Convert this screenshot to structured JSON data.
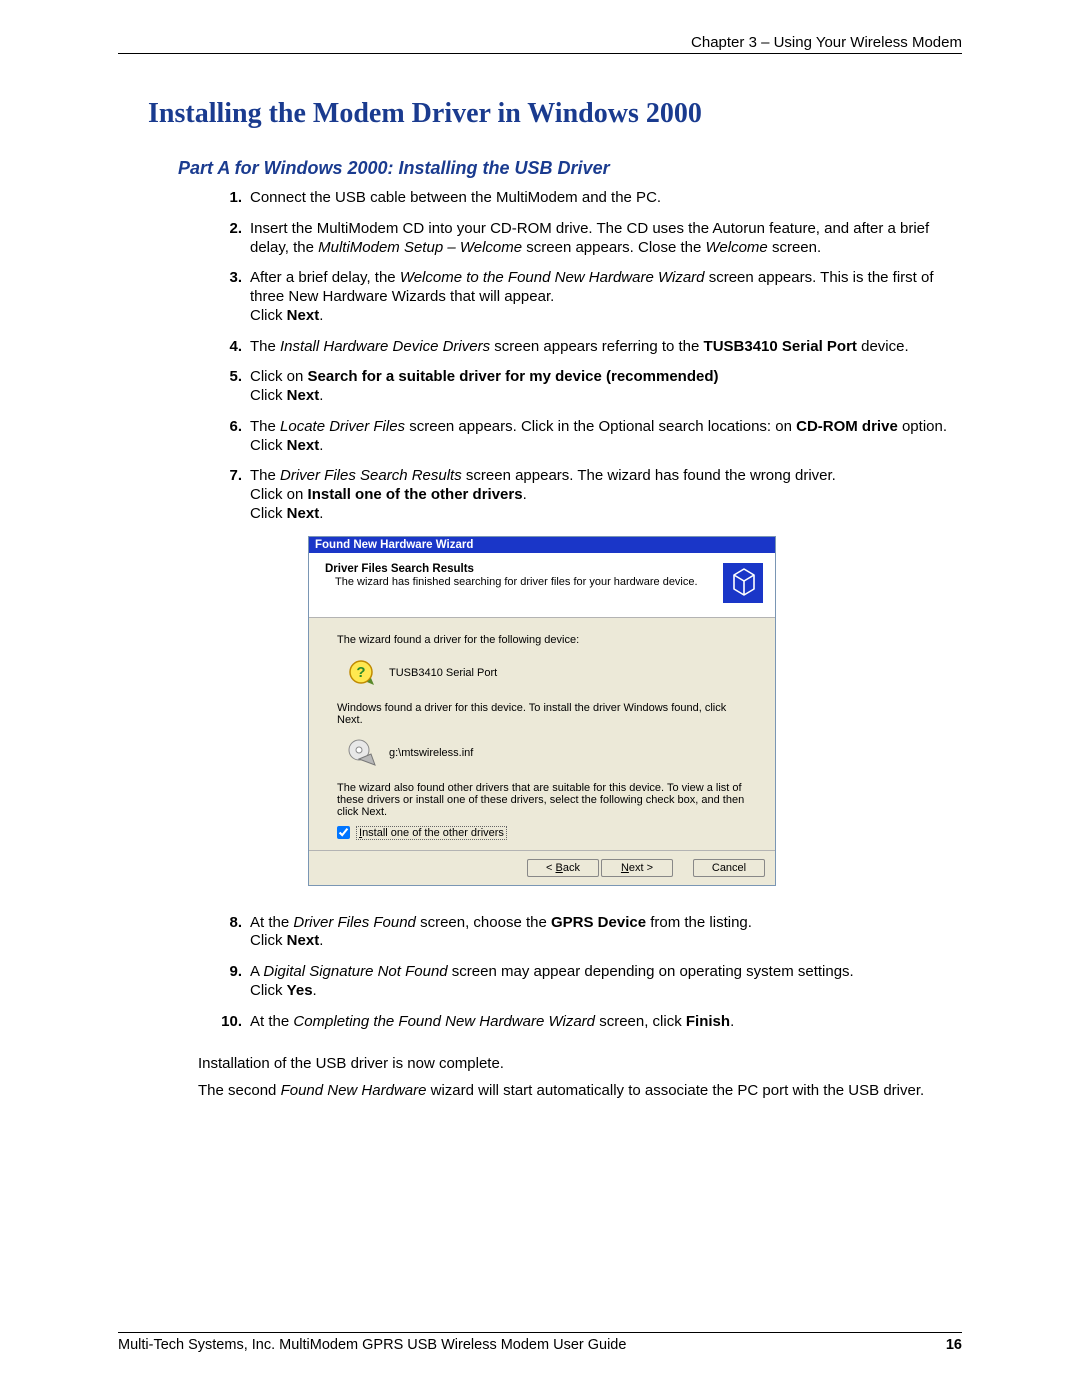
{
  "header": {
    "chapter": "Chapter 3 – Using Your Wireless Modem"
  },
  "h1": "Installing the Modem Driver in Windows 2000",
  "h2": "Part A for Windows 2000: Installing the USB Driver",
  "steps_a": {
    "s1_num": "1.",
    "s1": "Connect the USB cable between the MultiModem and the PC.",
    "s2_num": "2.",
    "s2_a": "Insert the MultiModem CD into your CD-ROM drive. The CD uses the Autorun feature, and after a brief delay, the ",
    "s2_i1": "MultiModem Setup – Welcome",
    "s2_b": " screen appears. Close the ",
    "s2_i2": "Welcome",
    "s2_c": " screen.",
    "s3_num": "3.",
    "s3_a": "After a brief delay, the ",
    "s3_i1": "Welcome to the Found New Hardware Wizard",
    "s3_b": " screen appears. This is the first of three New Hardware Wizards that will appear.",
    "s3_click_a": "Click ",
    "s3_click_b": "Next",
    "s3_click_c": ".",
    "s4_num": "4.",
    "s4_a": "The ",
    "s4_i1": "Install Hardware Device Drivers",
    "s4_b": " screen appears referring to the ",
    "s4_bold": "TUSB3410 Serial Port",
    "s4_c": " device.",
    "s5_num": "5.",
    "s5_a": "Click on ",
    "s5_bold": "Search for a suitable driver for my device (recommended)",
    "s5_click_a": "Click ",
    "s5_click_b": "Next",
    "s5_click_c": ".",
    "s6_num": "6.",
    "s6_a": "The ",
    "s6_i1": "Locate Driver Files",
    "s6_b": " screen appears. Click in the Optional search locations: on ",
    "s6_bold": "CD-ROM drive",
    "s6_c": " option.",
    "s6_click_a": "Click ",
    "s6_click_b": "Next",
    "s6_click_c": ".",
    "s7_num": "7.",
    "s7_a": "The ",
    "s7_i1": "Driver Files Search Results",
    "s7_b": " screen appears. The wizard has found the wrong driver.",
    "s7_line2_a": "Click on ",
    "s7_line2_b": "Install one of the other drivers",
    "s7_line2_c": ".",
    "s7_click_a": "Click ",
    "s7_click_b": "Next",
    "s7_click_c": "."
  },
  "wizard": {
    "title": "Found New Hardware Wizard",
    "head_title": "Driver Files Search Results",
    "head_sub": "The wizard has finished searching for driver files for your hardware device.",
    "b1": "The wizard found a driver for the following device:",
    "device": "TUSB3410 Serial Port",
    "b2": "Windows found a driver for this device. To install the driver Windows found, click Next.",
    "path": "g:\\mtswireless.inf",
    "b3": "The wizard also found other drivers that are suitable for this device. To view a list of these drivers or install one of these drivers, select the following check box, and then click Next.",
    "check_u": "I",
    "check_rest": "nstall one of the other drivers",
    "btn_back_u": "B",
    "btn_back_pre": "< ",
    "btn_back_rest": "ack",
    "btn_next_u": "N",
    "btn_next_rest": "ext >",
    "btn_cancel": "Cancel"
  },
  "steps_b": {
    "s8_num": "8.",
    "s8_a": "At the ",
    "s8_i1": "Driver Files Found",
    "s8_b": " screen, choose the ",
    "s8_bold": "GPRS Device",
    "s8_c": " from the listing.",
    "s8_click_a": "Click ",
    "s8_click_b": "Next",
    "s8_click_c": ".",
    "s9_num": "9.",
    "s9_a": "A ",
    "s9_i1": "Digital Signature Not Found",
    "s9_b": " screen may appear depending on operating system settings.",
    "s9_click_a": "Click ",
    "s9_click_b": "Yes",
    "s9_click_c": ".",
    "s10_num": "10.",
    "s10_a": "At the ",
    "s10_i1": "Completing the Found New Hardware Wizard",
    "s10_b": " screen, click ",
    "s10_bold": "Finish",
    "s10_c": "."
  },
  "closing": {
    "p1": "Installation of the USB driver is now complete.",
    "p2_a": "The second ",
    "p2_i": "Found New Hardware",
    "p2_b": " wizard will start automatically to associate the PC port with the USB driver."
  },
  "footer": {
    "left": "Multi-Tech Systems, Inc. MultiModem GPRS USB Wireless Modem User Guide",
    "right": "16"
  }
}
